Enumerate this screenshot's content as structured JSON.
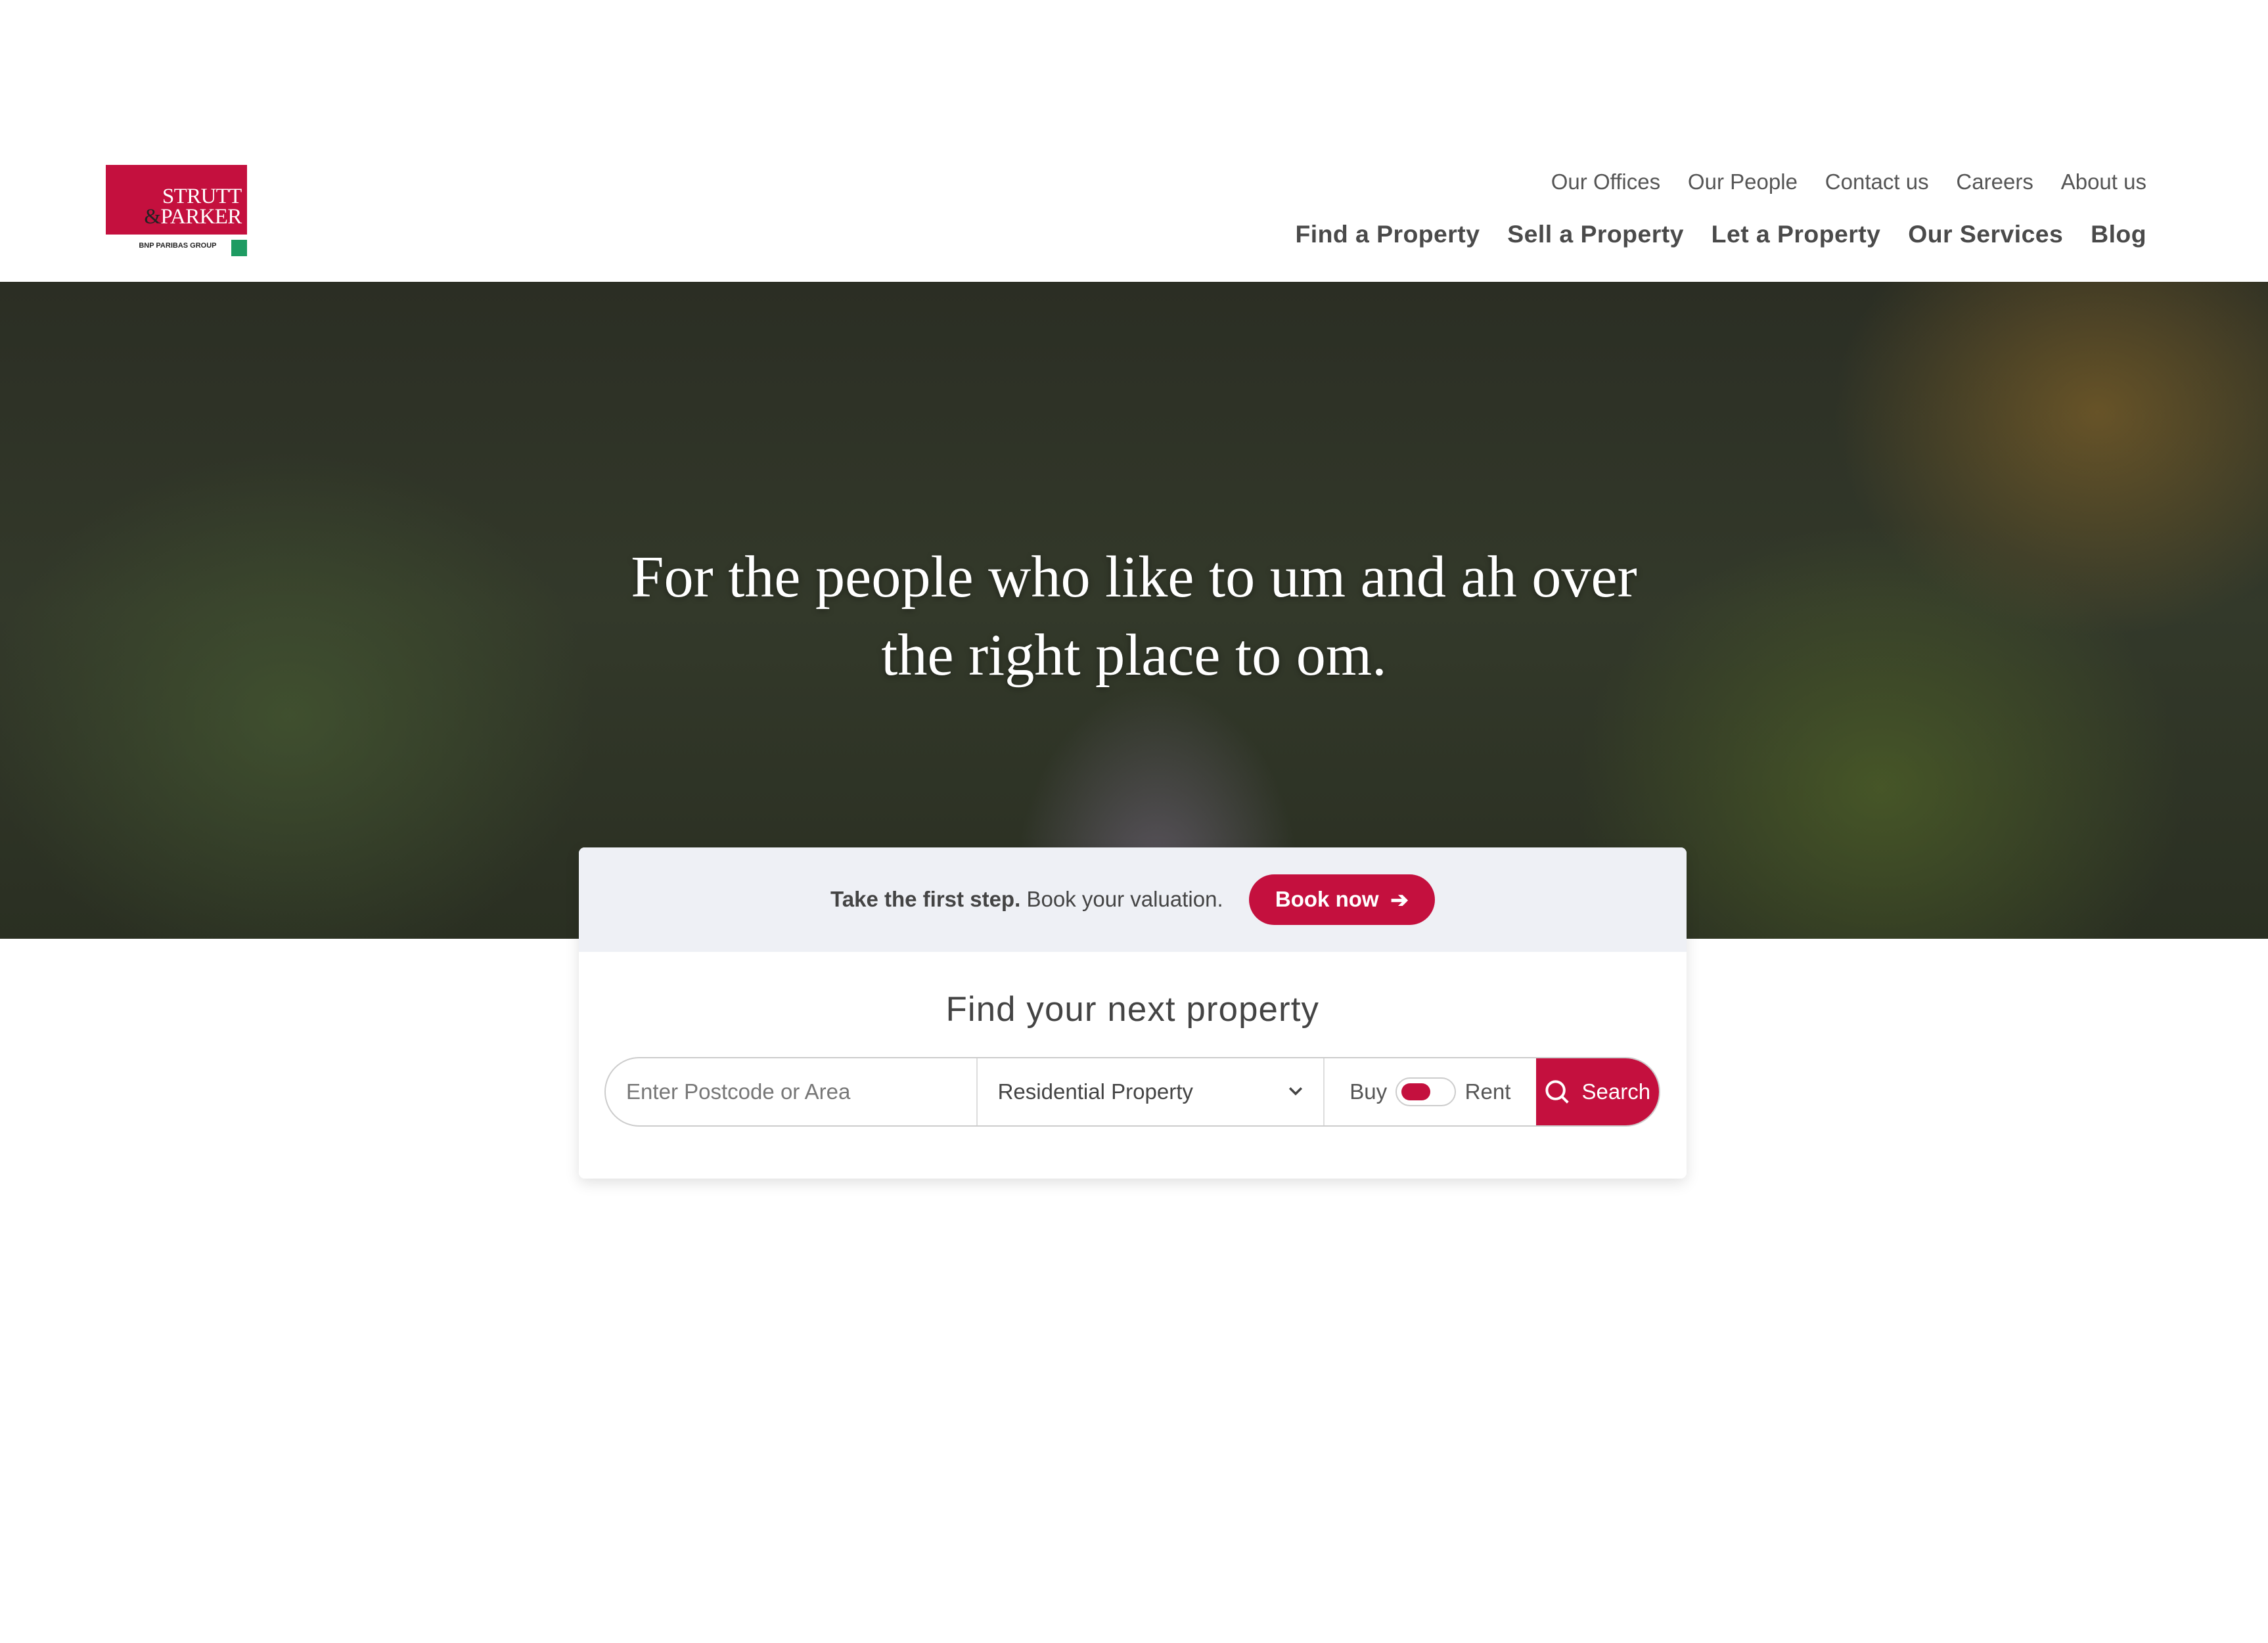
{
  "brand": {
    "name_line1": "STRUTT",
    "name_line2": "&PARKER",
    "group": "BNP PARIBAS GROUP",
    "color": "#c4103e"
  },
  "nav": {
    "secondary": [
      "Our Offices",
      "Our People",
      "Contact us",
      "Careers",
      "About us"
    ],
    "primary": [
      "Find a Property",
      "Sell a Property",
      "Let a Property",
      "Our Services",
      "Blog"
    ]
  },
  "hero": {
    "line1": "For the people who like to um and ah over",
    "line2": "the right place to om."
  },
  "valuation": {
    "bold": "Take the first step.",
    "text": "Book your valuation.",
    "button": "Book now",
    "button_icon": "arrow-right-icon"
  },
  "search": {
    "title": "Find your next property",
    "placeholder": "Enter Postcode or Area",
    "type_selected": "Residential Property",
    "toggle_left": "Buy",
    "toggle_right": "Rent",
    "toggle_state": "Buy",
    "button": "Search",
    "button_icon": "search-icon"
  }
}
